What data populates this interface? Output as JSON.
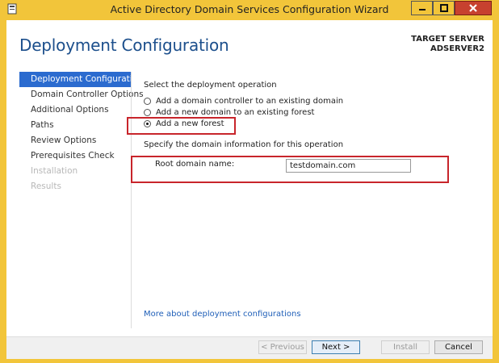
{
  "window": {
    "title": "Active Directory Domain Services Configuration Wizard"
  },
  "header": {
    "page_title": "Deployment Configuration",
    "target_label": "TARGET SERVER",
    "target_value": "ADSERVER2"
  },
  "sidebar": {
    "items": [
      {
        "label": "Deployment Configuration",
        "state": "active"
      },
      {
        "label": "Domain Controller Options",
        "state": "normal"
      },
      {
        "label": "Additional Options",
        "state": "normal"
      },
      {
        "label": "Paths",
        "state": "normal"
      },
      {
        "label": "Review Options",
        "state": "normal"
      },
      {
        "label": "Prerequisites Check",
        "state": "normal"
      },
      {
        "label": "Installation",
        "state": "disabled"
      },
      {
        "label": "Results",
        "state": "disabled"
      }
    ]
  },
  "main": {
    "operation_label": "Select the deployment operation",
    "options": [
      {
        "label": "Add a domain controller to an existing domain",
        "checked": false
      },
      {
        "label": "Add a new domain to an existing forest",
        "checked": false
      },
      {
        "label": "Add a new forest",
        "checked": true
      }
    ],
    "domain_info_label": "Specify the domain information for this operation",
    "root_domain_label": "Root domain name:",
    "root_domain_value": "testdomain.com",
    "more_link": "More about deployment configurations"
  },
  "footer": {
    "previous": "< Previous",
    "next": "Next >",
    "install": "Install",
    "cancel": "Cancel"
  },
  "colors": {
    "titlebar": "#f2c53a",
    "accent": "#2b6bcf",
    "heading": "#1c4f8c",
    "highlight_box": "#c8252b",
    "close_button": "#c7412f"
  }
}
